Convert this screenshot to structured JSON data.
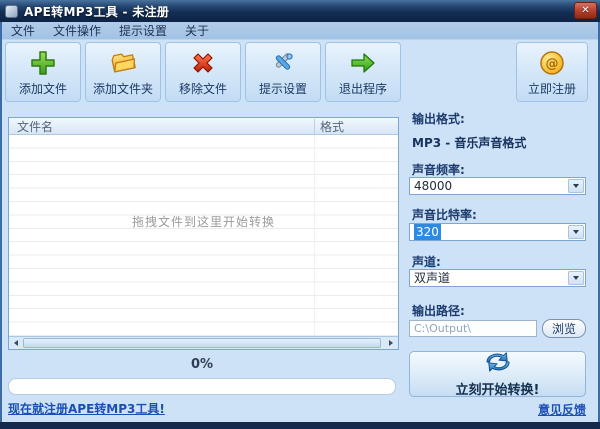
{
  "window": {
    "title": "APE转MP3工具 - 未注册",
    "close_glyph": "✕"
  },
  "menu_bar": {
    "items": [
      {
        "label": "文件"
      },
      {
        "label": "文件操作"
      },
      {
        "label": "提示设置"
      },
      {
        "label": "关于"
      }
    ]
  },
  "toolbar": {
    "buttons": [
      {
        "label": "添加文件",
        "icon": "add-file-plus-icon"
      },
      {
        "label": "添加文件夹",
        "icon": "add-folder-icon"
      },
      {
        "label": "移除文件",
        "icon": "remove-file-x-icon"
      },
      {
        "label": "提示设置",
        "icon": "settings-tools-icon"
      },
      {
        "label": "退出程序",
        "icon": "exit-arrow-icon"
      }
    ],
    "register_button": {
      "label": "立即注册",
      "icon": "gold-coin-icon"
    }
  },
  "file_list": {
    "columns": [
      {
        "label": "文件名"
      },
      {
        "label": "格式"
      }
    ],
    "empty_hint": "拖拽文件到这里开始转换"
  },
  "settings_panel": {
    "output_format": {
      "label": "输出格式:",
      "value": "MP3 - 音乐声音格式"
    },
    "frequency": {
      "label": "声音频率:",
      "value": "48000"
    },
    "bitrate": {
      "label": "声音比特率:",
      "value": "320"
    },
    "channel": {
      "label": "声道:",
      "value": "双声道"
    },
    "output_path": {
      "label": "输出路径:",
      "value": "C:\\Output\\",
      "browse_label": "浏览"
    },
    "convert_button": {
      "label": "立刻开始转换!"
    },
    "feedback_link": {
      "label": "意见反馈"
    }
  },
  "progress": {
    "percent_text": "0%",
    "value": 0
  },
  "footer": {
    "register_link": "现在就注册APE转MP3工具!"
  },
  "colors": {
    "titlebar_dark_blue": "#122c52",
    "close_button_red": "#bc4530",
    "selection_blue": "#2e8ae0",
    "link_blue": "#1a50b4",
    "panel_light_blue": "#cde2f6"
  }
}
